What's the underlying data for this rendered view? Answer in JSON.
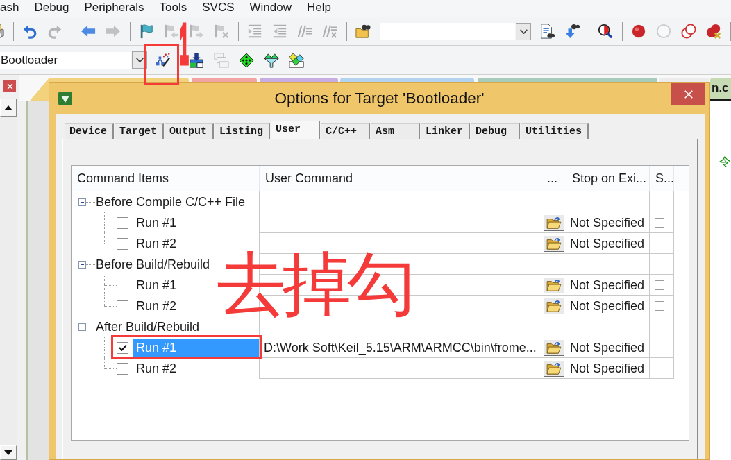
{
  "menu_bar": {
    "items": [
      "ash",
      "Debug",
      "Peripherals",
      "Tools",
      "SVCS",
      "Window",
      "Help"
    ]
  },
  "toolbar": {
    "items": [
      {
        "kind": "printer",
        "disabled": false
      },
      {
        "kind": "separator"
      },
      {
        "kind": "undo",
        "disabled": false
      },
      {
        "kind": "redo",
        "disabled": true
      },
      {
        "kind": "separator"
      },
      {
        "kind": "back",
        "disabled": false
      },
      {
        "kind": "forward",
        "disabled": true
      },
      {
        "kind": "separator"
      },
      {
        "kind": "bookmark",
        "disabled": false
      },
      {
        "kind": "bookmark_prev",
        "disabled": true
      },
      {
        "kind": "bookmark_next",
        "disabled": true
      },
      {
        "kind": "bookmark_clear",
        "disabled": true
      },
      {
        "kind": "separator"
      },
      {
        "kind": "indent",
        "disabled": true
      },
      {
        "kind": "unindent",
        "disabled": true
      },
      {
        "kind": "comment",
        "disabled": true
      },
      {
        "kind": "uncomment",
        "disabled": true
      },
      {
        "kind": "separator"
      },
      {
        "kind": "find_in_files",
        "disabled": false
      },
      {
        "kind": "find_combo"
      },
      {
        "kind": "find_doc",
        "disabled": false
      },
      {
        "kind": "find_next",
        "disabled": false
      },
      {
        "kind": "separator"
      },
      {
        "kind": "debug",
        "disabled": false
      },
      {
        "kind": "separator"
      },
      {
        "kind": "breakpoint",
        "disabled": false
      },
      {
        "kind": "breakpoint_enable",
        "disabled": true
      },
      {
        "kind": "breakpoints_disable",
        "disabled": false
      },
      {
        "kind": "breakpoints_kill",
        "disabled": false
      },
      {
        "kind": "separator"
      }
    ]
  },
  "target_toolbar": {
    "target": "Bootloader",
    "items": [
      {
        "kind": "options_wand",
        "disabled": false
      },
      {
        "kind": "separator"
      },
      {
        "kind": "load",
        "disabled": false
      },
      {
        "kind": "windows",
        "disabled": true
      },
      {
        "kind": "diamond",
        "disabled": false
      },
      {
        "kind": "funnel",
        "disabled": false
      },
      {
        "kind": "multi_diamond",
        "disabled": false
      }
    ]
  },
  "editor": {
    "tabs": [
      {
        "color": "#f2d27c"
      },
      {
        "color": "#f0a4a4"
      },
      {
        "color": "#c6aee2"
      },
      {
        "color": "#b2d2ef"
      },
      {
        "color": "#a8ccbc"
      },
      {
        "color": "#ececec"
      },
      {
        "label": "n.c",
        "color": "#c6dab4"
      }
    ],
    "visible_text": "令"
  },
  "dialog": {
    "title": "Options for Target 'Bootloader'",
    "tabs": [
      {
        "label": "Device",
        "selected": false
      },
      {
        "label": "Target",
        "selected": false
      },
      {
        "label": "Output",
        "selected": false
      },
      {
        "label": "Listing",
        "selected": false
      },
      {
        "label": "User",
        "selected": true
      },
      {
        "label": "C/C++",
        "selected": false
      },
      {
        "label": "Asm",
        "selected": false
      },
      {
        "label": "Linker",
        "selected": false
      },
      {
        "label": "Debug",
        "selected": false
      },
      {
        "label": "Utilities",
        "selected": false
      }
    ],
    "table": {
      "columns": [
        "Command Items",
        "User Command",
        "...",
        "Stop on Exi...",
        "S..."
      ],
      "groups": [
        {
          "label": "Before Compile C/C++ File",
          "expanded": true,
          "children": [
            {
              "label": "Run #1",
              "checked": false,
              "selected": false,
              "column_4": "Not Specified",
              "column_5_checked": false
            },
            {
              "label": "Run #2",
              "checked": false,
              "selected": false,
              "column_4": "Not Specified",
              "column_5_checked": false
            }
          ]
        },
        {
          "label": "Before Build/Rebuild",
          "expanded": true,
          "children": [
            {
              "label": "Run #1",
              "checked": false,
              "selected": false,
              "column_4": "Not Specified",
              "column_5_checked": false
            },
            {
              "label": "Run #2",
              "checked": false,
              "selected": false,
              "column_4": "Not Specified",
              "column_5_checked": false
            }
          ]
        },
        {
          "label": "After Build/Rebuild",
          "expanded": true,
          "children": [
            {
              "label": "Run #1",
              "checked": true,
              "selected": true,
              "user_command": "D:\\Work Soft\\Keil_5.15\\ARM\\ARMCC\\bin\\frome...",
              "column_4": "Not Specified",
              "column_5_checked": false
            },
            {
              "label": "Run #2",
              "checked": false,
              "selected": false,
              "column_4": "Not Specified",
              "column_5_checked": false
            }
          ]
        }
      ]
    }
  },
  "annotations": [
    {
      "kind": "text",
      "text": "1"
    },
    {
      "kind": "box"
    },
    {
      "kind": "text",
      "text": "去掉勾"
    },
    {
      "kind": "box"
    }
  ]
}
